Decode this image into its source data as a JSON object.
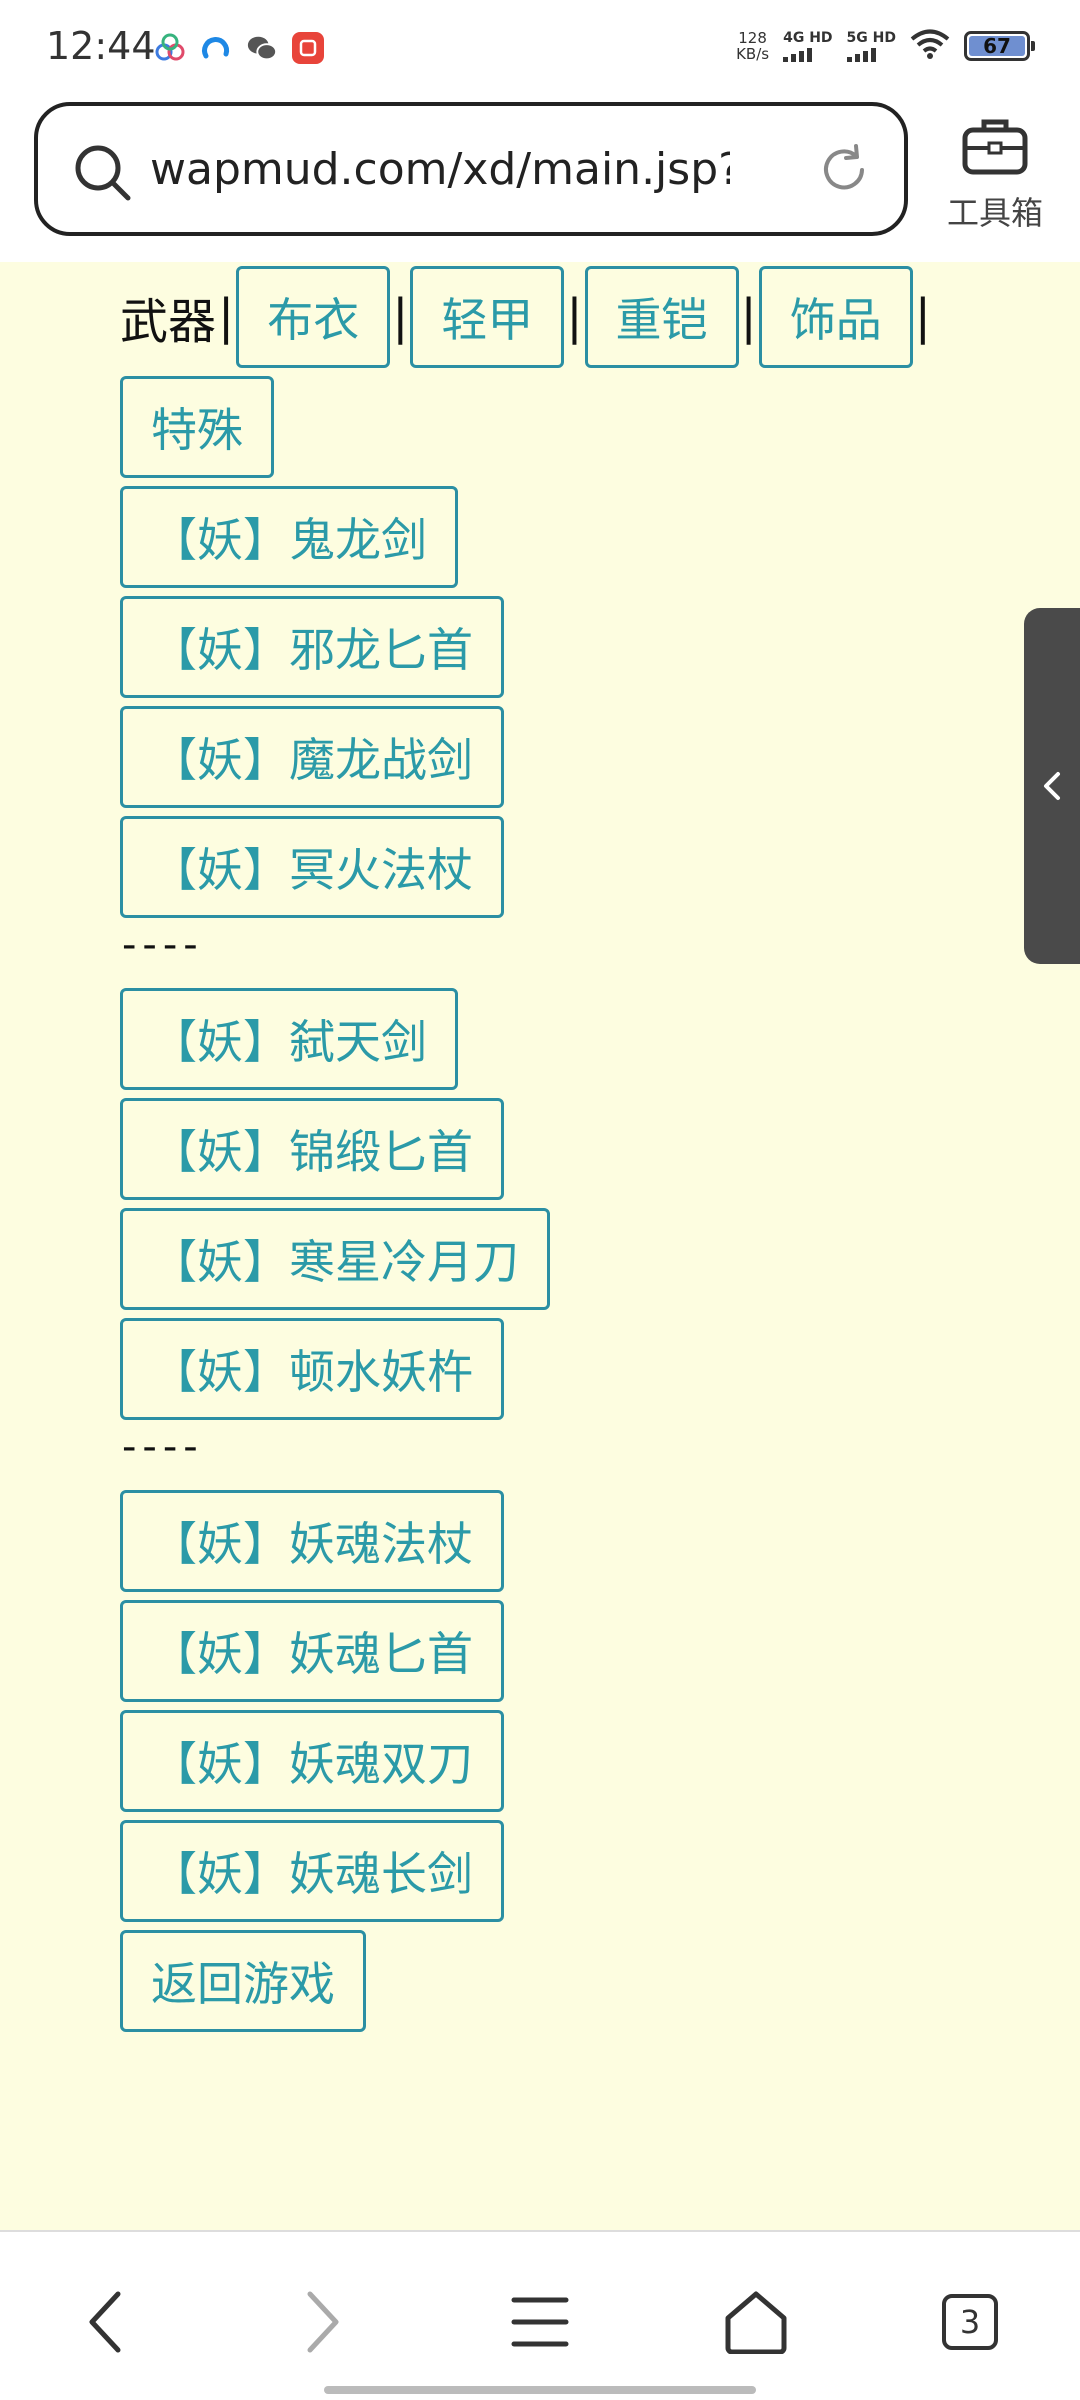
{
  "status": {
    "time": "12:44",
    "net_speed_value": "128",
    "net_speed_unit": "KB/s",
    "sim1": "4G HD",
    "sim2": "5G HD",
    "battery": "67"
  },
  "browser": {
    "url": "wapmud.com/xd/main.jsp?_…",
    "toolbox_label": "工具箱",
    "tab_count": "3"
  },
  "categories": {
    "current": "武器",
    "separator": "|",
    "items": [
      "布衣",
      "轻甲",
      "重铠",
      "饰品",
      "特殊"
    ]
  },
  "groups": [
    [
      "【妖】鬼龙剑",
      "【妖】邪龙匕首",
      "【妖】魔龙战剑",
      "【妖】冥火法杖"
    ],
    [
      "【妖】弑天剑",
      "【妖】锦缎匕首",
      "【妖】寒星冷月刀",
      "【妖】顿水妖杵"
    ],
    [
      "【妖】妖魂法杖",
      "【妖】妖魂匕首",
      "【妖】妖魂双刀",
      "【妖】妖魂长剑"
    ]
  ],
  "divider": "----",
  "return_label": "返回游戏",
  "colors": {
    "page_bg": "#fdfde0",
    "link": "#2b9aa8",
    "border": "#2b8fa3"
  }
}
